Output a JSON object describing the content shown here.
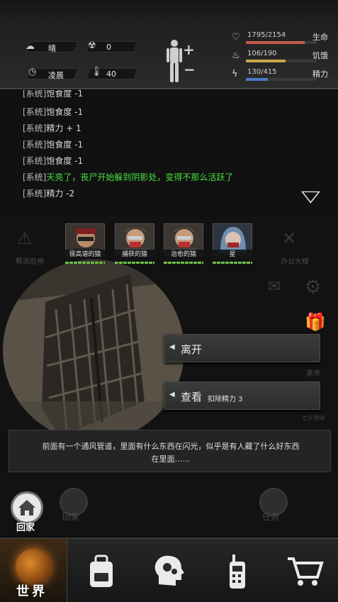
{
  "environment": {
    "weather": "晴",
    "radiation": "0",
    "time_of_day": "凌晨",
    "temperature": "40"
  },
  "stats": [
    {
      "label": "生命",
      "value": "1795/2154",
      "icon": "heart-icon",
      "fill": 0.83,
      "color": "#c65a4a"
    },
    {
      "label": "饥饿",
      "value": "106/190",
      "icon": "food-icon",
      "fill": 0.56,
      "color": "#c6a94a"
    },
    {
      "label": "精力",
      "value": "130/415",
      "icon": "energy-icon",
      "fill": 0.31,
      "color": "#4a7bc6"
    }
  ],
  "log": {
    "lines": [
      {
        "tag": "[系统]",
        "text": "饱食度 -1",
        "color": "#d8d8d8"
      },
      {
        "tag": "[系统]",
        "text": "饱食度 -1",
        "color": "#d8d8d8"
      },
      {
        "tag": "[系统]",
        "text": "精力 + 1",
        "color": "#d8d8d8"
      },
      {
        "tag": "[系统]",
        "text": "饱食度 -1",
        "color": "#d8d8d8"
      },
      {
        "tag": "[系统]",
        "text": "饱食度 -1",
        "color": "#d8d8d8"
      },
      {
        "tag": "[系统]",
        "text": "天亮了，丧尸开始躲到阴影处，变得不那么活跃了",
        "color": "#48e040"
      },
      {
        "tag": "[系统]",
        "text": "精力 -2",
        "color": "#d8d8d8"
      }
    ]
  },
  "scene": {
    "faded": {
      "left_label": "帮派驻地",
      "right_label": "办公大楼",
      "market_label": "黑市",
      "event_label": "七夕活动"
    },
    "survivors": [
      {
        "name": "很高谱的猿"
      },
      {
        "name": "捕获的猿"
      },
      {
        "name": "治愈的猿"
      },
      {
        "name": "星"
      }
    ],
    "actions": [
      {
        "label": "离开",
        "cost": ""
      },
      {
        "label": "查看",
        "cost": "扣除精力 3"
      }
    ],
    "description_line1": "前面有一个通风管道，里面有什么东西在闪光，似乎是有人藏了什么好东西",
    "description_line2": "在里面……"
  },
  "bottom": {
    "home_label": "回家",
    "ghost_home_label": "回家",
    "ghost_task_label": "任务"
  },
  "tabs": {
    "world": "世界"
  }
}
